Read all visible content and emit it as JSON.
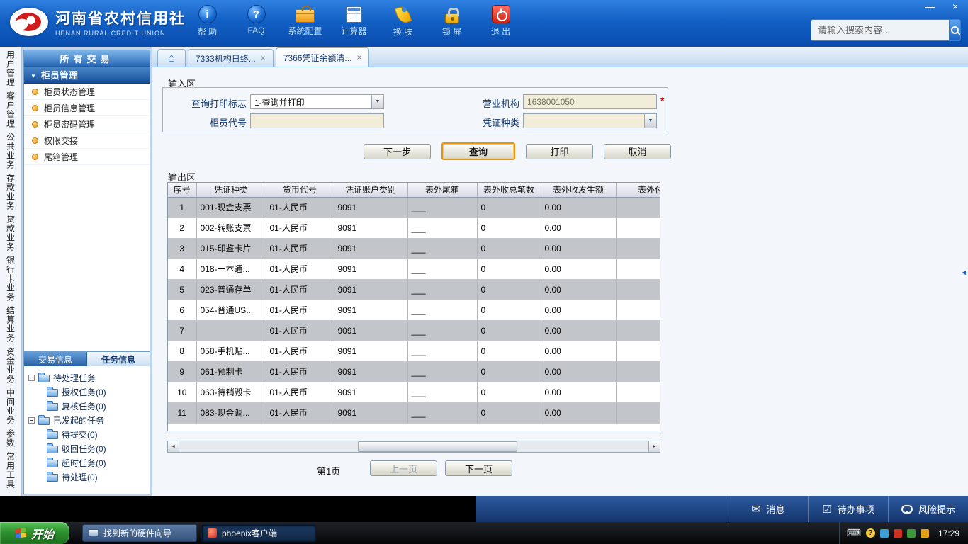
{
  "colors": {
    "header_blue": "#1260c4",
    "accent_orange": "#e8940a",
    "status_blue": "#15356c",
    "start_green": "#2f9230",
    "row_silver": "#c2c6ca"
  },
  "header": {
    "logo_title": "河南省农村信用社",
    "logo_subtitle": "HENAN RURAL CREDIT UNION",
    "tools": [
      {
        "label": "帮 助"
      },
      {
        "label": "FAQ"
      },
      {
        "label": "系统配置"
      },
      {
        "label": "计算器"
      },
      {
        "label": "换 肤"
      },
      {
        "label": "锁 屏"
      },
      {
        "label": "退 出"
      }
    ],
    "search_placeholder": "请输入搜索内容..."
  },
  "sidebar": {
    "categories": [
      "用户管理",
      "客户管理",
      "公共业务",
      "存款业务",
      "贷款业务",
      "银行卡业务",
      "结算业务",
      "资金业务",
      "中间业务",
      "参数",
      "常用工具"
    ],
    "title": "所有交易",
    "group": "柜员管理",
    "items": [
      "柜员状态管理",
      "柜员信息管理",
      "柜员密码管理",
      "权限交接",
      "尾箱管理"
    ],
    "info_tabs": [
      "交易信息",
      "任务信息"
    ],
    "tree": [
      {
        "label": "待处理任务",
        "cls": "root"
      },
      {
        "label": "授权任务(0)",
        "cls": "child"
      },
      {
        "label": "复核任务(0)",
        "cls": "child"
      },
      {
        "label": "已发起的任务",
        "cls": "root"
      },
      {
        "label": "待提交(0)",
        "cls": "child"
      },
      {
        "label": "驳回任务(0)",
        "cls": "child"
      },
      {
        "label": "超时任务(0)",
        "cls": "child"
      },
      {
        "label": "待处理(0)",
        "cls": "child"
      }
    ]
  },
  "workspace_tabs": [
    {
      "label": "7333机构日终..."
    },
    {
      "label": "7366凭证余额清..."
    }
  ],
  "input_section": {
    "title": "输入区",
    "print_flag_label": "查询打印标志",
    "print_flag_value": "1-查询并打印",
    "org_label": "营业机构",
    "org_value": "1638001050",
    "required_mark": "*",
    "teller_label": "柜员代号",
    "teller_value": "",
    "voucher_label": "凭证种类",
    "voucher_value": "",
    "buttons": {
      "next": "下一步",
      "query": "查询",
      "print": "打印",
      "cancel": "取消"
    }
  },
  "output_section": {
    "title": "输出区",
    "columns": [
      "序号",
      "凭证种类",
      "货币代号",
      "凭证账户类别",
      "表外尾箱",
      "表外收总笔数",
      "表外收发生额",
      "表外付总"
    ],
    "rows": [
      [
        "1",
        "001-现金支票",
        "01-人民币",
        "9091",
        "___",
        "0",
        "0.00",
        ""
      ],
      [
        "2",
        "002-转账支票",
        "01-人民币",
        "9091",
        "___",
        "0",
        "0.00",
        ""
      ],
      [
        "3",
        "015-印鉴卡片",
        "01-人民币",
        "9091",
        "___",
        "0",
        "0.00",
        ""
      ],
      [
        "4",
        "018-一本通...",
        "01-人民币",
        "9091",
        "___",
        "0",
        "0.00",
        ""
      ],
      [
        "5",
        "023-普通存单",
        "01-人民币",
        "9091",
        "___",
        "0",
        "0.00",
        ""
      ],
      [
        "6",
        "054-普通US...",
        "01-人民币",
        "9091",
        "___",
        "0",
        "0.00",
        ""
      ],
      [
        "7",
        "",
        "01-人民币",
        "9091",
        "___",
        "0",
        "0.00",
        ""
      ],
      [
        "8",
        "058-手机贴...",
        "01-人民币",
        "9091",
        "___",
        "0",
        "0.00",
        ""
      ],
      [
        "9",
        "061-预制卡",
        "01-人民币",
        "9091",
        "___",
        "0",
        "0.00",
        ""
      ],
      [
        "10",
        "063-待销毁卡",
        "01-人民币",
        "9091",
        "___",
        "0",
        "0.00",
        ""
      ],
      [
        "11",
        "083-现金调...",
        "01-人民币",
        "9091",
        "___",
        "0",
        "0.00",
        ""
      ]
    ],
    "page_label": "第1页",
    "prev": "上一页",
    "next": "下一页"
  },
  "status_bar": {
    "items": [
      {
        "label": "消息"
      },
      {
        "label": "待办事项"
      },
      {
        "label": "风险提示"
      }
    ]
  },
  "taskbar": {
    "start": "开始",
    "tasks": [
      {
        "label": "找到新的硬件向导"
      },
      {
        "label": "phoenix客户端"
      }
    ],
    "time": "17:29"
  }
}
